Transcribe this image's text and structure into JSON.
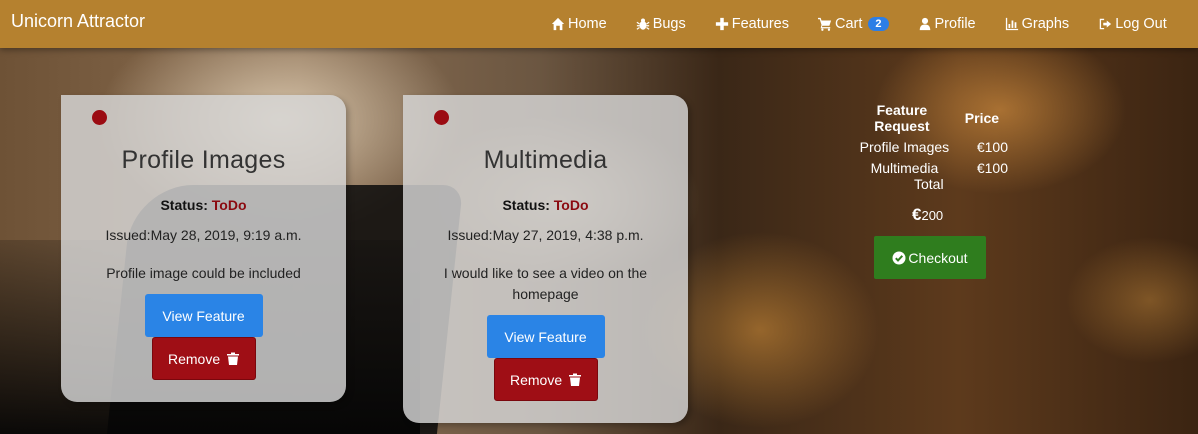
{
  "navbar": {
    "brand": "Unicorn Attractor",
    "links": [
      {
        "label": "Home",
        "icon": "home-icon"
      },
      {
        "label": "Bugs",
        "icon": "bug-icon"
      },
      {
        "label": " Features",
        "icon": "plus-icon"
      },
      {
        "label": " Cart",
        "icon": "cart-icon",
        "badge": "2"
      },
      {
        "label": "Profile",
        "icon": "user-icon"
      },
      {
        "label": " Graphs",
        "icon": "bar-chart-icon"
      },
      {
        "label": " Log Out",
        "icon": "sign-out-icon"
      }
    ],
    "color": "#b5812f"
  },
  "cards": [
    {
      "title": "Profile Images",
      "status_label": "Status:",
      "status_value": "ToDo",
      "issued": "Issued:May 28, 2019, 9:19 a.m.",
      "description": "Profile image could be included",
      "view_label": "View Feature",
      "remove_label": "Remove"
    },
    {
      "title": "Multimedia",
      "status_label": "Status:",
      "status_value": "ToDo",
      "issued": "Issued:May 27, 2019, 4:38 p.m.",
      "description": "I would like to see a video on the homepage",
      "view_label": "View Feature",
      "remove_label": "Remove"
    }
  ],
  "cart": {
    "headers": [
      "Feature Request",
      "Price"
    ],
    "rows": [
      {
        "name": "Profile Images",
        "price": "€100"
      },
      {
        "name": "Multimedia",
        "price": "€100"
      }
    ],
    "total_label": "Total",
    "total_currency": "€",
    "total_amount": "200",
    "checkout_label": "Checkout"
  },
  "colors": {
    "status_todo": "#8b0a10",
    "view_button": "#2a84e6",
    "remove_button": "#9f0e15",
    "checkout_button": "#2f7d1e",
    "cart_badge": "#2c7ee6"
  }
}
